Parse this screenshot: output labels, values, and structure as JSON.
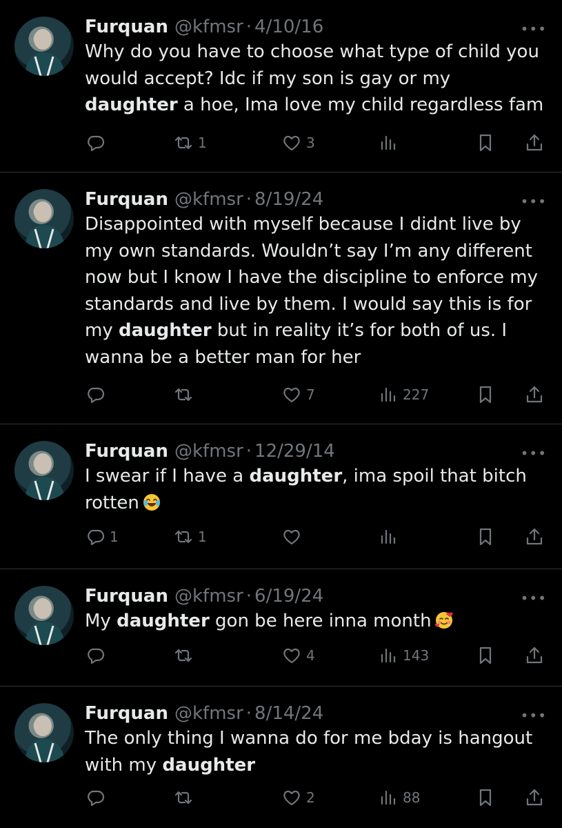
{
  "tweets": [
    {
      "name": "Furquan",
      "handle": "@kfmsr",
      "separator": "·",
      "date": "4/10/16",
      "text_parts": [
        "Why do you have to choose what type of child you would accept? Idc if my son is gay or my ",
        "daughter",
        " a hoe, Ima love my child regardless fam"
      ],
      "replies": "",
      "retweets": "1",
      "likes": "3",
      "views": "",
      "emoji": ""
    },
    {
      "name": "Furquan",
      "handle": "@kfmsr",
      "separator": "·",
      "date": "8/19/24",
      "text_parts": [
        "Disappointed with myself because I didnt live by my own standards. Wouldn’t say I’m any different now but I know I have the discipline to enforce my standards and live by them. I would say this is for my ",
        "daughter",
        " but in reality it’s for both of us. I wanna be a better man for her"
      ],
      "replies": "",
      "retweets": "",
      "likes": "7",
      "views": "227",
      "emoji": ""
    },
    {
      "name": "Furquan",
      "handle": "@kfmsr",
      "separator": "·",
      "date": "12/29/14",
      "text_parts": [
        "I swear if I have a ",
        "daughter",
        ", ima spoil that bitch rotten"
      ],
      "replies": "1",
      "retweets": "1",
      "likes": "",
      "views": "",
      "emoji": "laughing-tears-emoji"
    },
    {
      "name": "Furquan",
      "handle": "@kfmsr",
      "separator": "·",
      "date": "6/19/24",
      "text_parts": [
        "My ",
        "daughter",
        " gon be here inna month"
      ],
      "replies": "",
      "retweets": "",
      "likes": "4",
      "views": "143",
      "emoji": "smiling-hearts-emoji"
    },
    {
      "name": "Furquan",
      "handle": "@kfmsr",
      "separator": "·",
      "date": "8/14/24",
      "text_parts": [
        "The only thing I wanna do for me bday is hangout with my ",
        "daughter",
        ""
      ],
      "replies": "",
      "retweets": "",
      "likes": "2",
      "views": "88",
      "emoji": ""
    }
  ],
  "icons": {
    "more": "ellipsis-icon",
    "reply": "reply-icon",
    "retweet": "retweet-icon",
    "like": "heart-icon",
    "views": "views-icon",
    "bookmark": "bookmark-icon",
    "share": "share-icon"
  },
  "colors": {
    "background": "#000000",
    "text": "#e7e9ea",
    "secondary": "#71767b",
    "divider": "#2f3336"
  }
}
